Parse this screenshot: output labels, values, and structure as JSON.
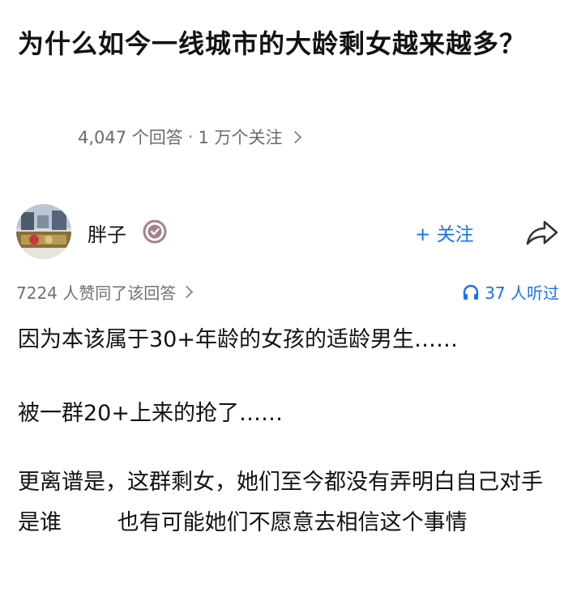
{
  "question": {
    "title": "为什么如今一线城市的大龄剩女越来越多？",
    "answer_count": "4,047 个回答",
    "separator": "·",
    "follower_count": "1 万个关注"
  },
  "author": {
    "name": "胖子",
    "follow_label": "+ 关注"
  },
  "answer": {
    "upvote_text": "7224 人赞同了该回答",
    "listen_text": "37 人听过",
    "paragraphs": [
      "因为本该属于30+年龄的女孩的适龄男生……",
      "被一群20+上来的抢了……",
      "更离谱是，这群剩女，她们至今都没有弄明白自己对手是谁        也有可能她们不愿意去相信这个事情"
    ]
  },
  "colors": {
    "accent": "#1772f6",
    "text": "#121212",
    "meta": "#6b6b6b"
  },
  "icons": [
    "chevron-right-icon",
    "verified-badge-icon",
    "share-icon",
    "headphone-icon"
  ]
}
